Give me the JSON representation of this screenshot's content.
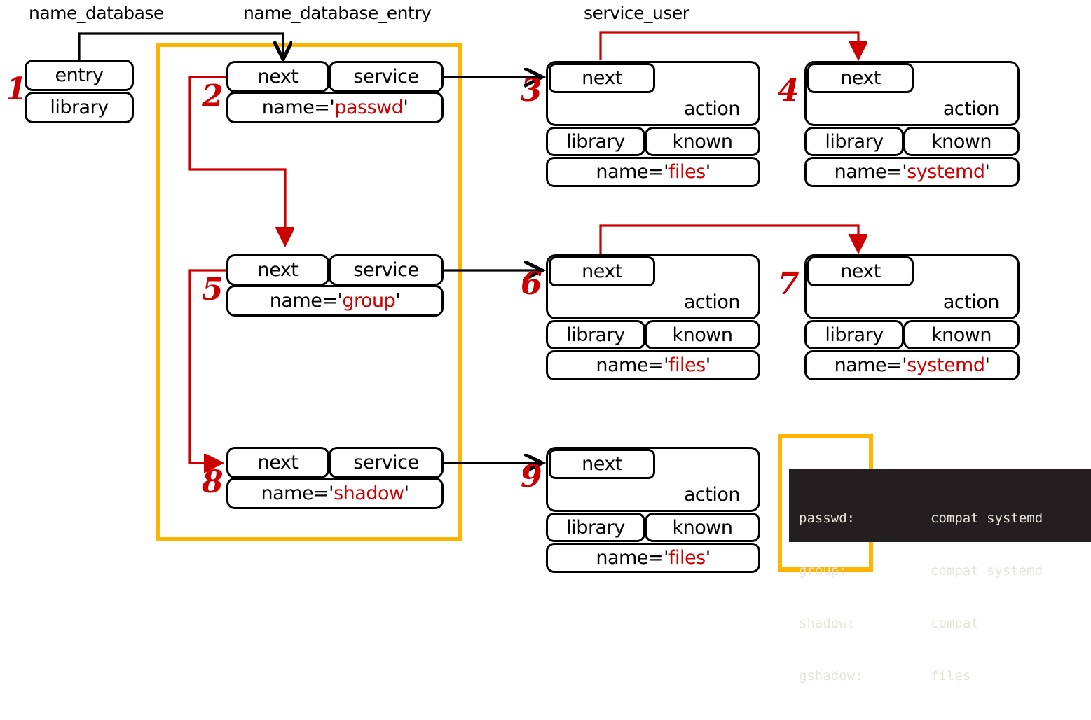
{
  "colors": {
    "red": "#cc0000",
    "black": "#000000",
    "orange": "#ffb400",
    "terminal_bg": "#231f20",
    "terminal_fg": "#e8e4dc"
  },
  "labels": {
    "name_database": "name_database",
    "name_database_entry": "name_database_entry",
    "service_user": "service_user"
  },
  "field_names": {
    "entry": "entry",
    "library": "library",
    "next": "next",
    "service": "service",
    "action": "action",
    "known": "known"
  },
  "nodes": [
    {
      "index": "1",
      "kind": "name_database",
      "rows": [
        "entry",
        "library"
      ]
    },
    {
      "index": "2",
      "kind": "name_database_entry",
      "next": "next",
      "service": "service",
      "name_prefix": "name='",
      "name_value": "passwd",
      "name_suffix": "'"
    },
    {
      "index": "3",
      "kind": "service_user",
      "next": "next",
      "action": "action",
      "library": "library",
      "known": "known",
      "name_prefix": "name='",
      "name_value": "files",
      "name_suffix": "'"
    },
    {
      "index": "4",
      "kind": "service_user",
      "next": "next",
      "action": "action",
      "library": "library",
      "known": "known",
      "name_prefix": "name='",
      "name_value": "systemd",
      "name_suffix": "'"
    },
    {
      "index": "5",
      "kind": "name_database_entry",
      "next": "next",
      "service": "service",
      "name_prefix": "name='",
      "name_value": "group",
      "name_suffix": "'"
    },
    {
      "index": "6",
      "kind": "service_user",
      "next": "next",
      "action": "action",
      "library": "library",
      "known": "known",
      "name_prefix": "name='",
      "name_value": "files",
      "name_suffix": "'"
    },
    {
      "index": "7",
      "kind": "service_user",
      "next": "next",
      "action": "action",
      "library": "library",
      "known": "known",
      "name_prefix": "name='",
      "name_value": "systemd",
      "name_suffix": "'"
    },
    {
      "index": "8",
      "kind": "name_database_entry",
      "next": "next",
      "service": "service",
      "name_prefix": "name='",
      "name_value": "shadow",
      "name_suffix": "'"
    },
    {
      "index": "9",
      "kind": "service_user",
      "next": "next",
      "action": "action",
      "library": "library",
      "known": "known",
      "name_prefix": "name='",
      "name_value": "files",
      "name_suffix": "'"
    }
  ],
  "terminal": {
    "lines": [
      {
        "key": "passwd:",
        "value": "compat systemd"
      },
      {
        "key": "group:",
        "value": "compat systemd"
      },
      {
        "key": "shadow:",
        "value": "compat"
      },
      {
        "key": "gshadow:",
        "value": "files"
      }
    ]
  }
}
